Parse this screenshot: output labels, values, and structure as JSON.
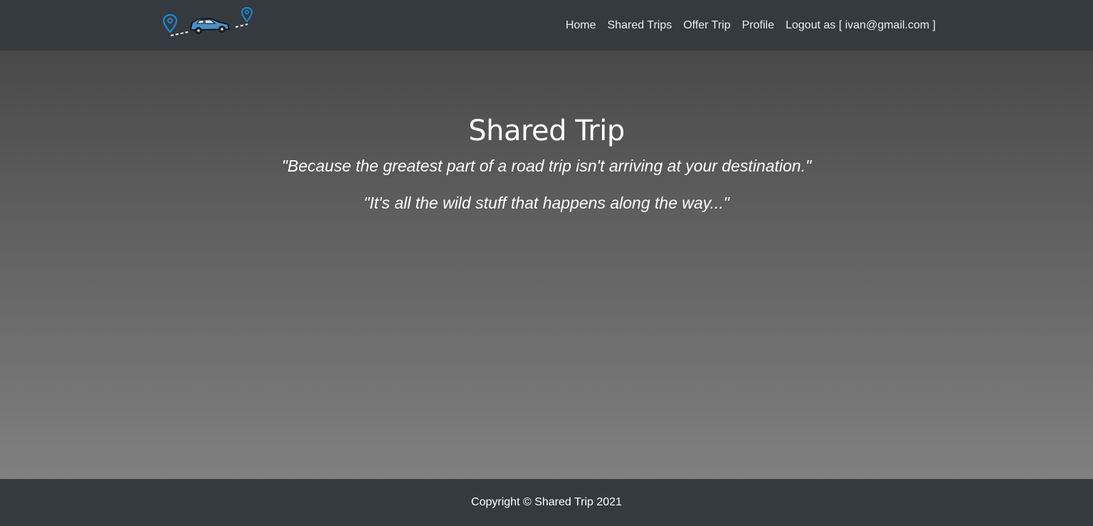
{
  "brand": {
    "logo_icon": "road-trip-car-logo-icon",
    "accent_color": "#1e88d4"
  },
  "nav": {
    "items": [
      {
        "label": "Home"
      },
      {
        "label": "Shared Trips"
      },
      {
        "label": "Offer Trip"
      },
      {
        "label": "Profile"
      },
      {
        "label": "Logout as [ ivan@gmail.com ]"
      }
    ]
  },
  "hero": {
    "title": "Shared Trip",
    "quote_1": "\"Because the greatest part of a road trip isn't arriving at your destination.\"",
    "quote_2": "\"It's all the wild stuff that happens along the way...\""
  },
  "footer": {
    "copyright": "Copyright © Shared Trip 2021"
  },
  "colors": {
    "navbar_bg": "#343a40",
    "footer_bg": "#343a40",
    "text": "#ffffff"
  }
}
